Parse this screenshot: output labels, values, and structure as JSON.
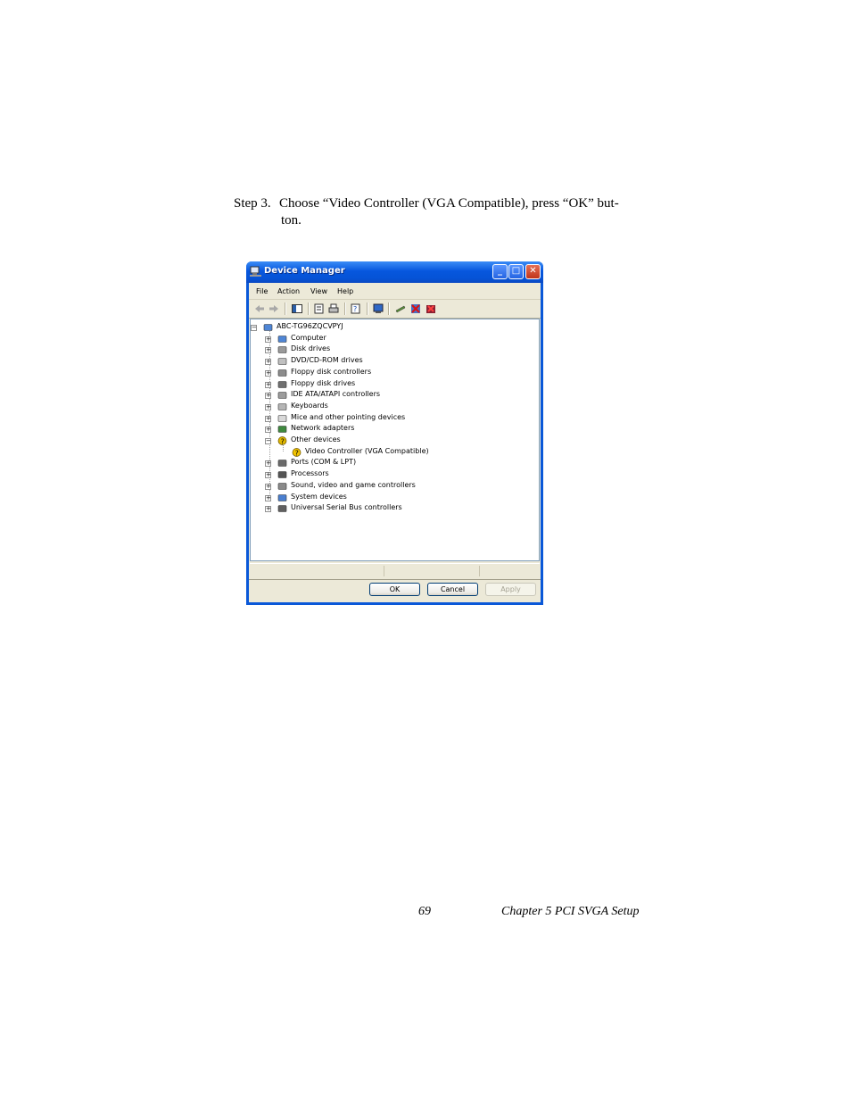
{
  "step": {
    "number": "Step 3.",
    "text_line1": "Choose “Video Controller (VGA Compatible), press “OK” but-",
    "text_line2": "ton."
  },
  "window": {
    "title": "Device Manager",
    "controls": {
      "minimize": "_",
      "maximize": "□",
      "close": "✕"
    },
    "menu": [
      "File",
      "Action",
      "View",
      "Help"
    ],
    "tree": {
      "root": "ABC-TG96ZQCVPYJ",
      "categories": [
        {
          "label": "Computer",
          "icon": "computer-icon"
        },
        {
          "label": "Disk drives",
          "icon": "disk-drive-icon"
        },
        {
          "label": "DVD/CD-ROM drives",
          "icon": "cdrom-icon"
        },
        {
          "label": "Floppy disk controllers",
          "icon": "floppy-controller-icon"
        },
        {
          "label": "Floppy disk drives",
          "icon": "floppy-drive-icon"
        },
        {
          "label": "IDE ATA/ATAPI controllers",
          "icon": "ide-controller-icon"
        },
        {
          "label": "Keyboards",
          "icon": "keyboard-icon"
        },
        {
          "label": "Mice and other pointing devices",
          "icon": "mouse-icon"
        },
        {
          "label": "Network adapters",
          "icon": "network-adapter-icon"
        },
        {
          "label": "Other devices",
          "icon": "unknown-device-icon"
        },
        {
          "label": "Ports (COM & LPT)",
          "icon": "port-icon"
        },
        {
          "label": "Processors",
          "icon": "processor-icon"
        },
        {
          "label": "Sound, video and game controllers",
          "icon": "sound-icon"
        },
        {
          "label": "System devices",
          "icon": "system-device-icon"
        },
        {
          "label": "Universal Serial Bus controllers",
          "icon": "usb-icon"
        }
      ],
      "child": {
        "label": "Video Controller (VGA Compatible)",
        "icon": "warning-device-icon"
      }
    },
    "buttons": {
      "ok": "OK",
      "cancel": "Cancel",
      "apply": "Apply"
    }
  },
  "footer": {
    "page_number": "69",
    "chapter": "Chapter 5  PCI SVGA Setup"
  },
  "colors": {
    "titlebar": "#0653d6",
    "window_bg": "#ece9d8",
    "tree_bg": "#ffffff"
  }
}
